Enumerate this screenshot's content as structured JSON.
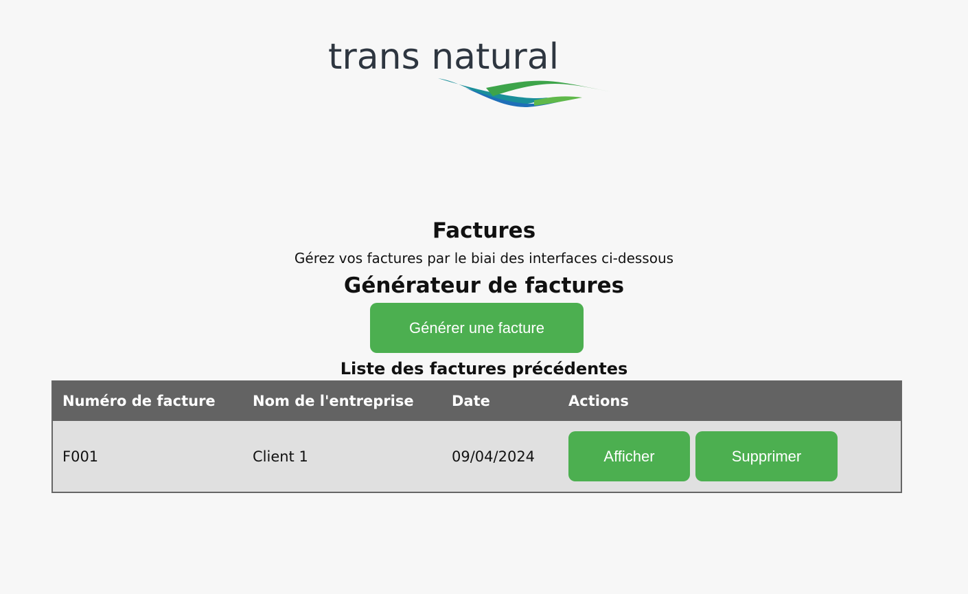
{
  "brand": {
    "logo_text": "trans natural",
    "colors": {
      "text": "#2e3640",
      "wave_teal": "#1a8f9a",
      "wave_blue": "#1f6fb8",
      "wave_green": "#3da44a"
    }
  },
  "header": {
    "title": "Factures",
    "subtitle": "Gérez vos factures par le biai des interfaces ci-dessous"
  },
  "generator": {
    "title": "Générateur de factures",
    "button_label": "Générer une facture"
  },
  "invoices": {
    "title": "Liste des factures précédentes",
    "columns": [
      "Numéro de facture",
      "Nom de l'entreprise",
      "Date",
      "Actions"
    ],
    "rows": [
      {
        "number": "F001",
        "company": "Client 1",
        "date": "09/04/2024",
        "show_label": "Afficher",
        "delete_label": "Supprimer"
      }
    ]
  },
  "theme": {
    "accent": "#4caf50",
    "table_header_bg": "#636363",
    "table_row_bg": "#e0e0e0",
    "page_bg": "#f7f7f7"
  }
}
